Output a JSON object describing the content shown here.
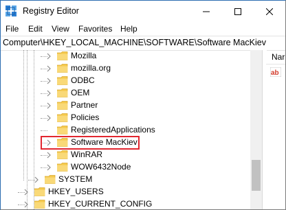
{
  "window": {
    "title": "Registry Editor"
  },
  "menu": [
    "File",
    "Edit",
    "View",
    "Favorites",
    "Help"
  ],
  "address": "Computer\\HKEY_LOCAL_MACHINE\\SOFTWARE\\Software MacKiev",
  "tree": [
    {
      "label": "Mozilla",
      "expandable": true
    },
    {
      "label": "mozilla.org",
      "expandable": true
    },
    {
      "label": "ODBC",
      "expandable": true
    },
    {
      "label": "OEM",
      "expandable": true
    },
    {
      "label": "Partner",
      "expandable": true
    },
    {
      "label": "Policies",
      "expandable": true
    },
    {
      "label": "RegisteredApplications",
      "expandable": false
    },
    {
      "label": "Software MacKiev",
      "expandable": true,
      "highlighted": true
    },
    {
      "label": "WinRAR",
      "expandable": true
    },
    {
      "label": "WOW6432Node",
      "expandable": true
    },
    {
      "label": "SYSTEM",
      "expandable": true
    },
    {
      "label": "HKEY_USERS",
      "expandable": true
    },
    {
      "label": "HKEY_CURRENT_CONFIG",
      "expandable": true
    }
  ],
  "right_pane": {
    "column_header": "Nar"
  },
  "colors": {
    "highlight_border": "#e2262f",
    "folder": "#f5c94c"
  }
}
